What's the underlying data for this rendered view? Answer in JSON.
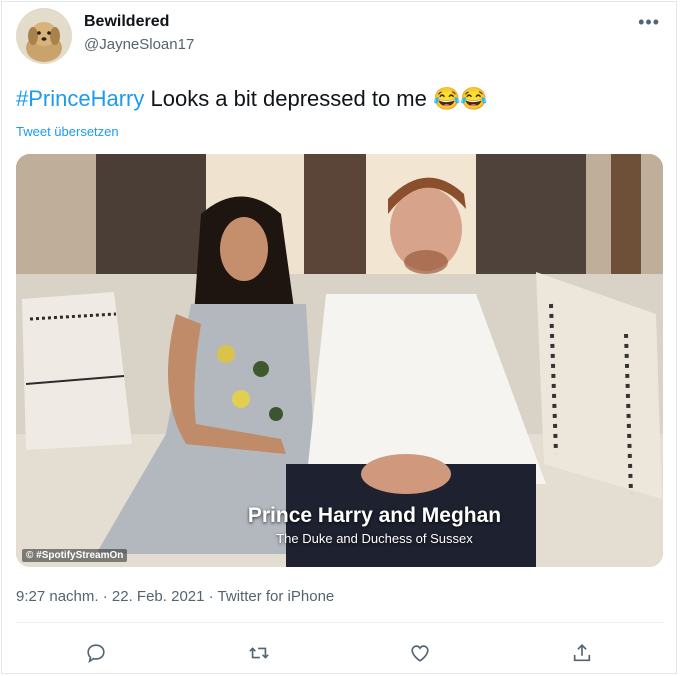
{
  "author": {
    "display_name": "Bewildered",
    "handle": "@JayneSloan17",
    "avatar_icon": "dog-avatar"
  },
  "tweet": {
    "hashtag": "#PrinceHarry",
    "text": " Looks a bit depressed to me ",
    "emoji": "😂😂",
    "translate_label": "Tweet übersetzen"
  },
  "media": {
    "caption_title": "Prince Harry and Meghan",
    "caption_subtitle": "The Duke and Duchess of Sussex",
    "watermark": "© #SpotifyStreamOn"
  },
  "meta": {
    "time": "9:27 nachm.",
    "separator1": " · ",
    "date": "22. Feb. 2021",
    "separator2": " · ",
    "source": "Twitter for iPhone"
  },
  "actions": {
    "reply_icon": "reply-icon",
    "retweet_icon": "retweet-icon",
    "like_icon": "like-icon",
    "share_icon": "share-icon"
  },
  "colors": {
    "link": "#1d9bf0",
    "secondary_text": "#536471",
    "primary_text": "#0f1419"
  }
}
